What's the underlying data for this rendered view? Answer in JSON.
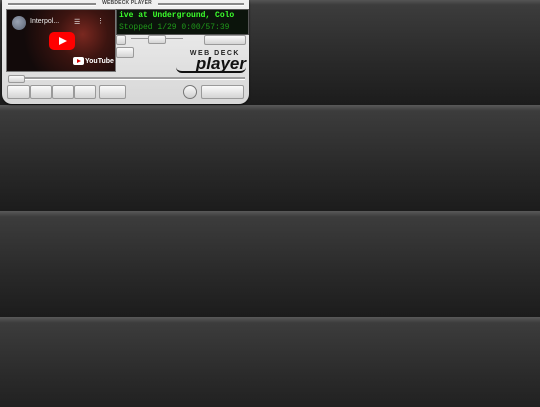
{
  "window": {
    "title": "WEBDECK PLAYER"
  },
  "video": {
    "title": "Interpol...",
    "provider": "YouTube"
  },
  "lcd": {
    "track_text": "ive at Underground, Colo",
    "status_text": "Stopped 1/29 0:00/57:39"
  },
  "logo": {
    "top": "WEB DECK",
    "bottom": "player"
  },
  "seek": {
    "position": 0.0
  },
  "icons": [
    "channel-avatar",
    "playlist-icon",
    "more-icon",
    "play-icon",
    "youtube-logo"
  ]
}
